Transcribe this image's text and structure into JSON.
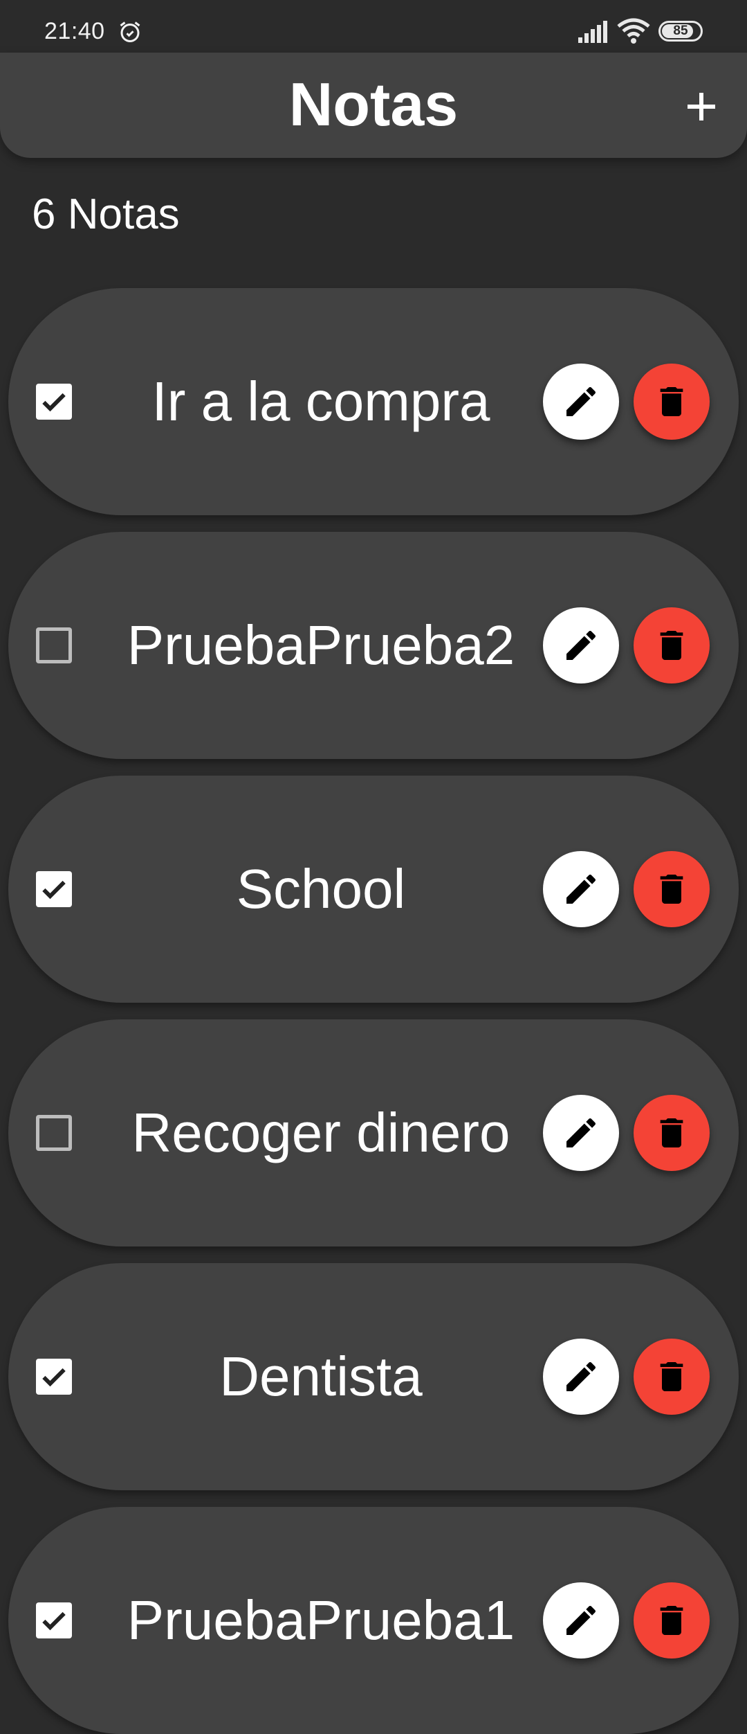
{
  "status_bar": {
    "time": "21:40",
    "battery_level": "85",
    "battery_fraction": 0.85,
    "icons": [
      "alarm-icon",
      "signal-icon",
      "wifi-icon",
      "battery-icon"
    ]
  },
  "app_bar": {
    "title": "Notas",
    "add_icon": "plus-icon"
  },
  "notes_count_label": "6 Notas",
  "colors": {
    "background": "#2b2b2b",
    "card": "#424242",
    "delete": "#f44336",
    "edit": "#ffffff"
  },
  "notes": [
    {
      "title": "Ir a la compra",
      "done": true
    },
    {
      "title": "PruebaPrueba2",
      "done": false
    },
    {
      "title": "School",
      "done": true
    },
    {
      "title": "Recoger dinero",
      "done": false
    },
    {
      "title": "Dentista",
      "done": true
    },
    {
      "title": "PruebaPrueba1",
      "done": true
    }
  ],
  "note_actions": {
    "edit_icon": "pencil-icon",
    "delete_icon": "trash-icon"
  }
}
